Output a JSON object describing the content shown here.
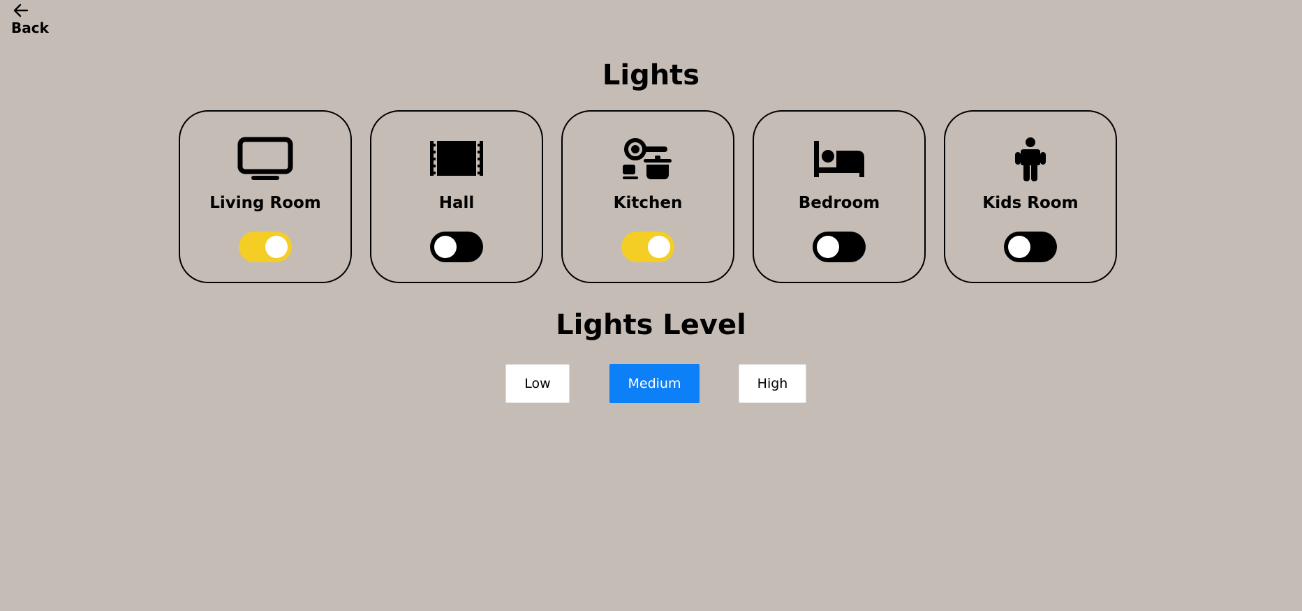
{
  "back": {
    "label": "Back"
  },
  "title": "Lights",
  "rooms": [
    {
      "name": "Living Room",
      "icon": "tv-icon",
      "on": true
    },
    {
      "name": "Hall",
      "icon": "hall-icon",
      "on": false
    },
    {
      "name": "Kitchen",
      "icon": "kitchen-icon",
      "on": true
    },
    {
      "name": "Bedroom",
      "icon": "bed-icon",
      "on": false
    },
    {
      "name": "Kids Room",
      "icon": "child-icon",
      "on": false
    }
  ],
  "levels": {
    "title": "Lights Level",
    "options": [
      {
        "label": "Low",
        "selected": false
      },
      {
        "label": "Medium",
        "selected": true
      },
      {
        "label": "High",
        "selected": false
      }
    ]
  },
  "colors": {
    "background": "#c5bcb6",
    "toggle_on": "#f4ce25",
    "toggle_off": "#000000",
    "selected_button": "#0d7ff7"
  }
}
